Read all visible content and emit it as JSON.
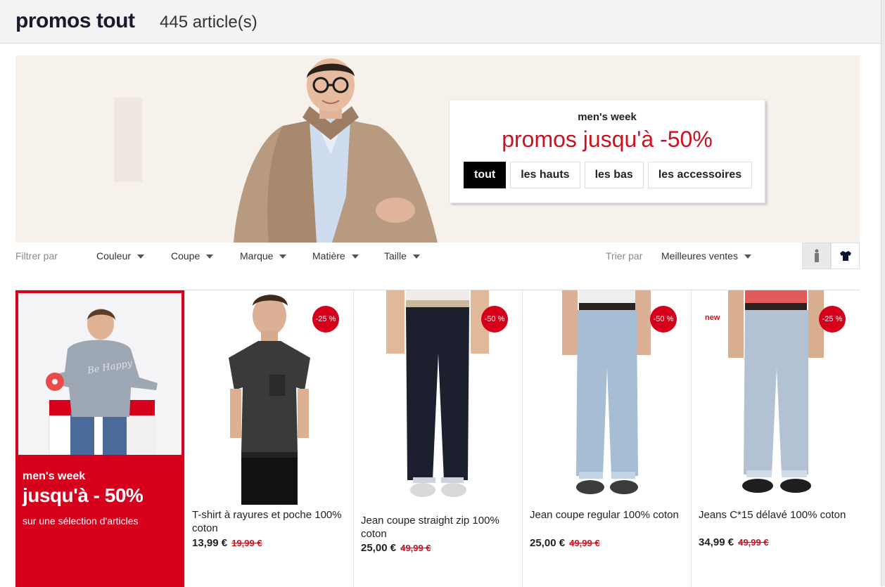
{
  "header": {
    "title": "promos tout",
    "count": "445 article(s)"
  },
  "hero": {
    "kicker": "men's week",
    "headline": "promos jusqu'à -50%",
    "tabs": [
      "tout",
      "les hauts",
      "les bas",
      "les accessoires"
    ],
    "active_tab": "tout"
  },
  "filters": {
    "label": "Filtrer par",
    "items": [
      "Couleur",
      "Coupe",
      "Marque",
      "Matière",
      "Taille"
    ],
    "sort_label": "Trier par",
    "sort_value": "Meilleures ventes",
    "view_icons": [
      "model-view-icon",
      "product-view-icon"
    ]
  },
  "promo_card": {
    "line1": "men's week",
    "line2": "jusqu'à - 50%",
    "line3": "sur une sélection d'articles",
    "shirt_text": "Be Happy"
  },
  "products": [
    {
      "name": "T-shirt à rayures et poche 100% coton",
      "price": "13,99 €",
      "old_price": "19,99 €",
      "badge": "-25 %"
    },
    {
      "name": "Jean coupe straight zip 100% coton",
      "price": "25,00 €",
      "old_price": "49,99 €",
      "badge": "-50 %"
    },
    {
      "name": "Jean coupe regular 100% coton",
      "price": "25,00 €",
      "old_price": "49,99 €",
      "badge": "-50 %"
    },
    {
      "name": "Jeans C*15 délavé 100% coton",
      "price": "34,99 €",
      "old_price": "49,99 €",
      "badge": "-25 %",
      "tag": "new"
    }
  ],
  "colors": {
    "accent": "#cc1120",
    "promo_red": "#d6001c",
    "title": "#1a1a2e"
  }
}
